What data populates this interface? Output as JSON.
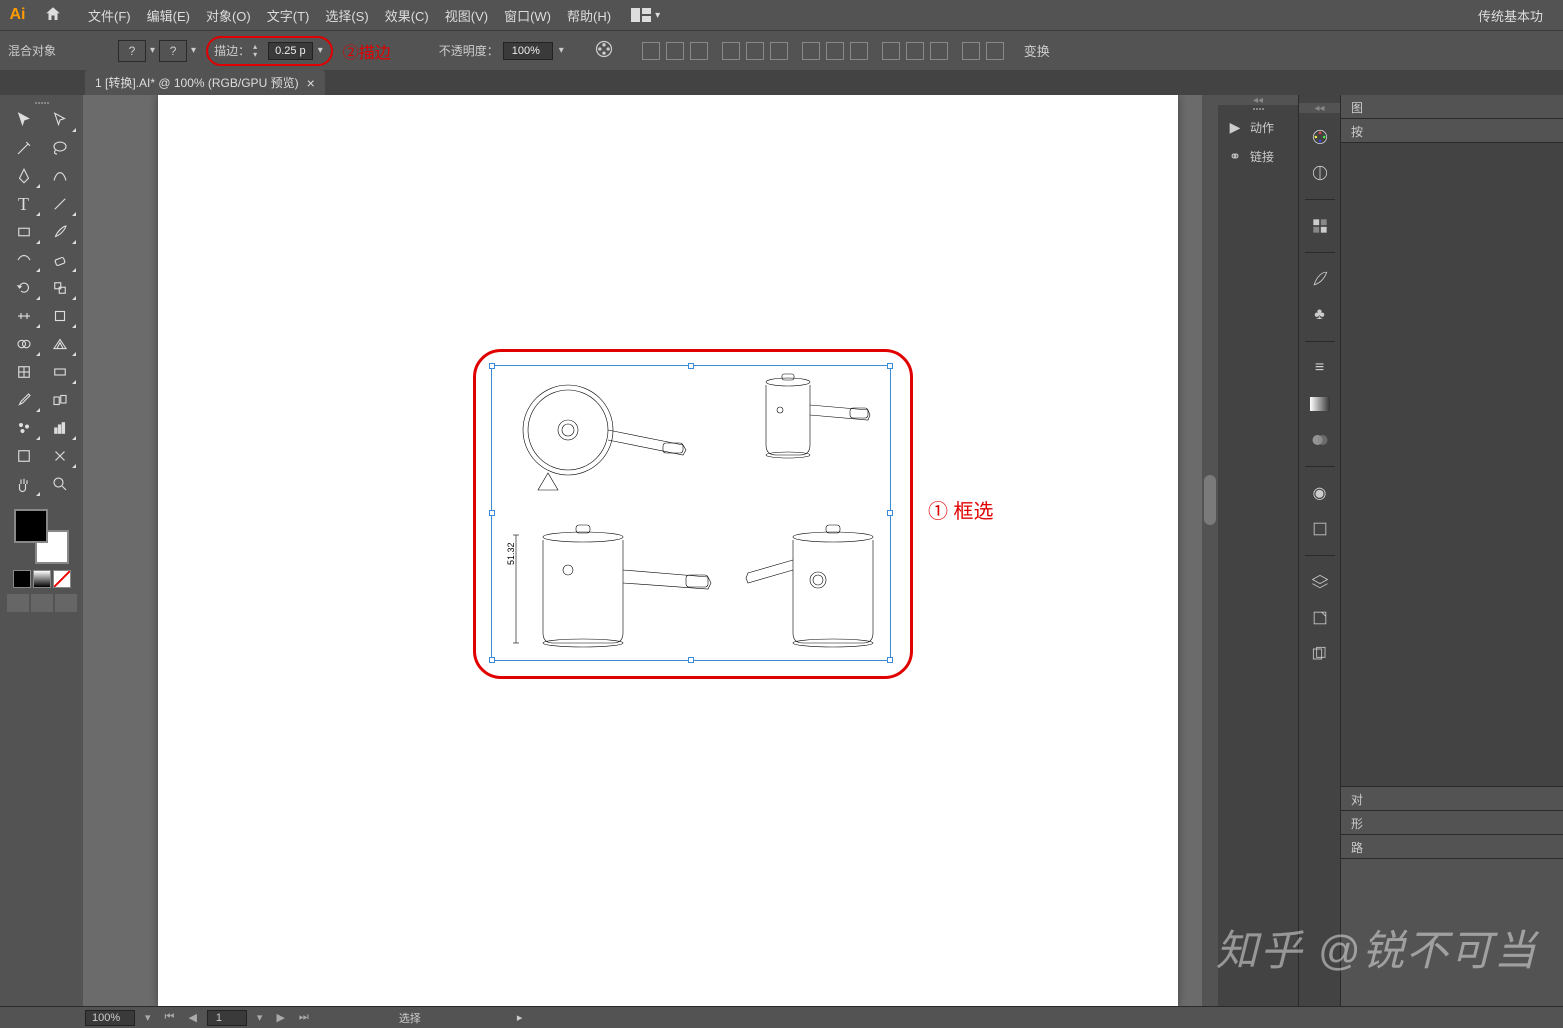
{
  "app": {
    "logo": "Ai",
    "workspace_label": "传统基本功"
  },
  "menu": {
    "file": "文件(F)",
    "edit": "编辑(E)",
    "object": "对象(O)",
    "type": "文字(T)",
    "select": "选择(S)",
    "effect": "效果(C)",
    "view": "视图(V)",
    "window": "窗口(W)",
    "help": "帮助(H)"
  },
  "control": {
    "blend_label": "混合对象",
    "fill_placeholder": "?",
    "stroke_placeholder": "?",
    "stroke_label": "描边：",
    "stroke_value": "0.25 p",
    "opacity_label": "不透明度：",
    "opacity_value": "100%",
    "transform_label": "变换"
  },
  "annotations": {
    "ann1": "① 框选",
    "ann2": "②描边"
  },
  "doc": {
    "tab_title": "1 [转换].AI* @ 100% (RGB/GPU 预览)",
    "close": "×"
  },
  "panels": {
    "actions": "动作",
    "links": "链接",
    "right_tabs": {
      "r1": "图",
      "r2": "按"
    },
    "bottom_tabs": {
      "t1": "对",
      "t2": "形",
      "t3": "路"
    }
  },
  "status": {
    "zoom": "100%",
    "page": "1",
    "selection_label": "选择"
  },
  "artwork": {
    "dim_label": "51.32"
  },
  "watermark": "知乎 @锐不可当"
}
